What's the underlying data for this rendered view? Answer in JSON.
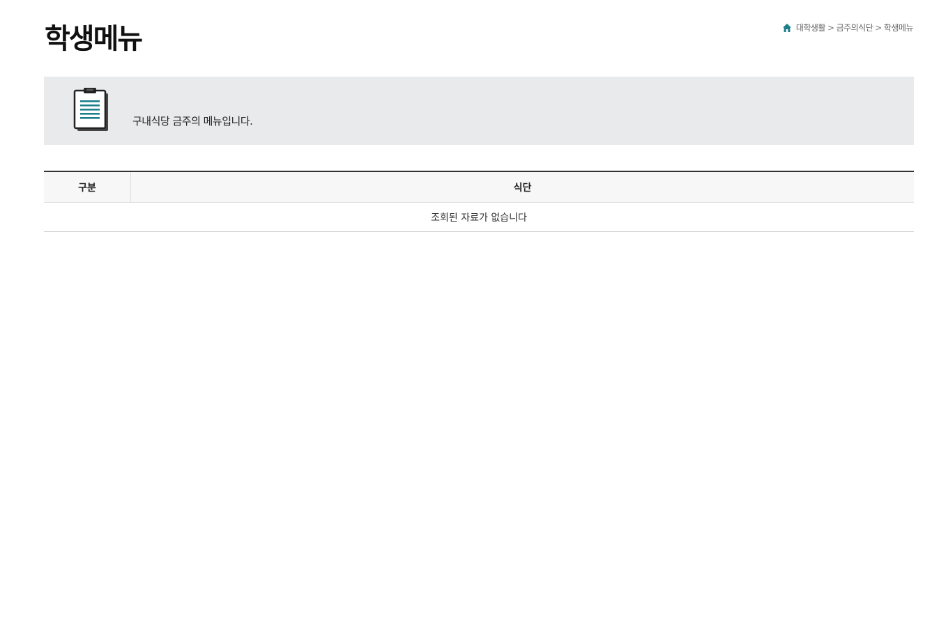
{
  "header": {
    "title": "학생메뉴"
  },
  "breadcrumb": {
    "items": [
      "대학생활",
      "금주의식단",
      "학생메뉴"
    ],
    "separator": ">",
    "home_icon": "home-icon"
  },
  "notice": {
    "icon": "clipboard-icon",
    "message": "구내식당 금주의 메뉴입니다."
  },
  "table": {
    "columns": [
      "구분",
      "식단"
    ],
    "rows": [],
    "empty_message": "조회된 자료가 없습니다"
  },
  "colors": {
    "accent": "#1d7f8c",
    "notice_bg": "#e9eaec",
    "table_top_border": "#333333",
    "table_header_bg": "#f7f7f7"
  }
}
